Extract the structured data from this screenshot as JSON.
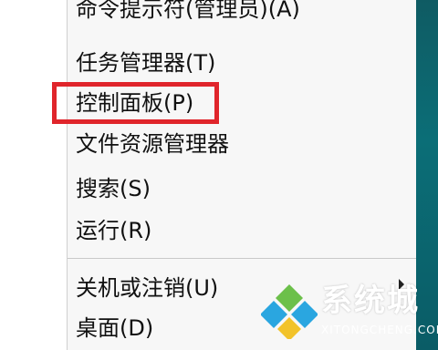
{
  "menu": {
    "items": [
      {
        "label": "命令提示符(管理员)(A)"
      },
      {
        "label": "任务管理器(T)"
      },
      {
        "label": "控制面板(P)"
      },
      {
        "label": "文件资源管理器"
      },
      {
        "label": "搜索(S)"
      },
      {
        "label": "运行(R)"
      },
      {
        "label": "关机或注销(U)"
      },
      {
        "label": "桌面(D)"
      }
    ]
  },
  "highlight_color": "#e0252b",
  "watermark": {
    "brand": "系统城",
    "url": "XITONGCHENG.COM"
  }
}
